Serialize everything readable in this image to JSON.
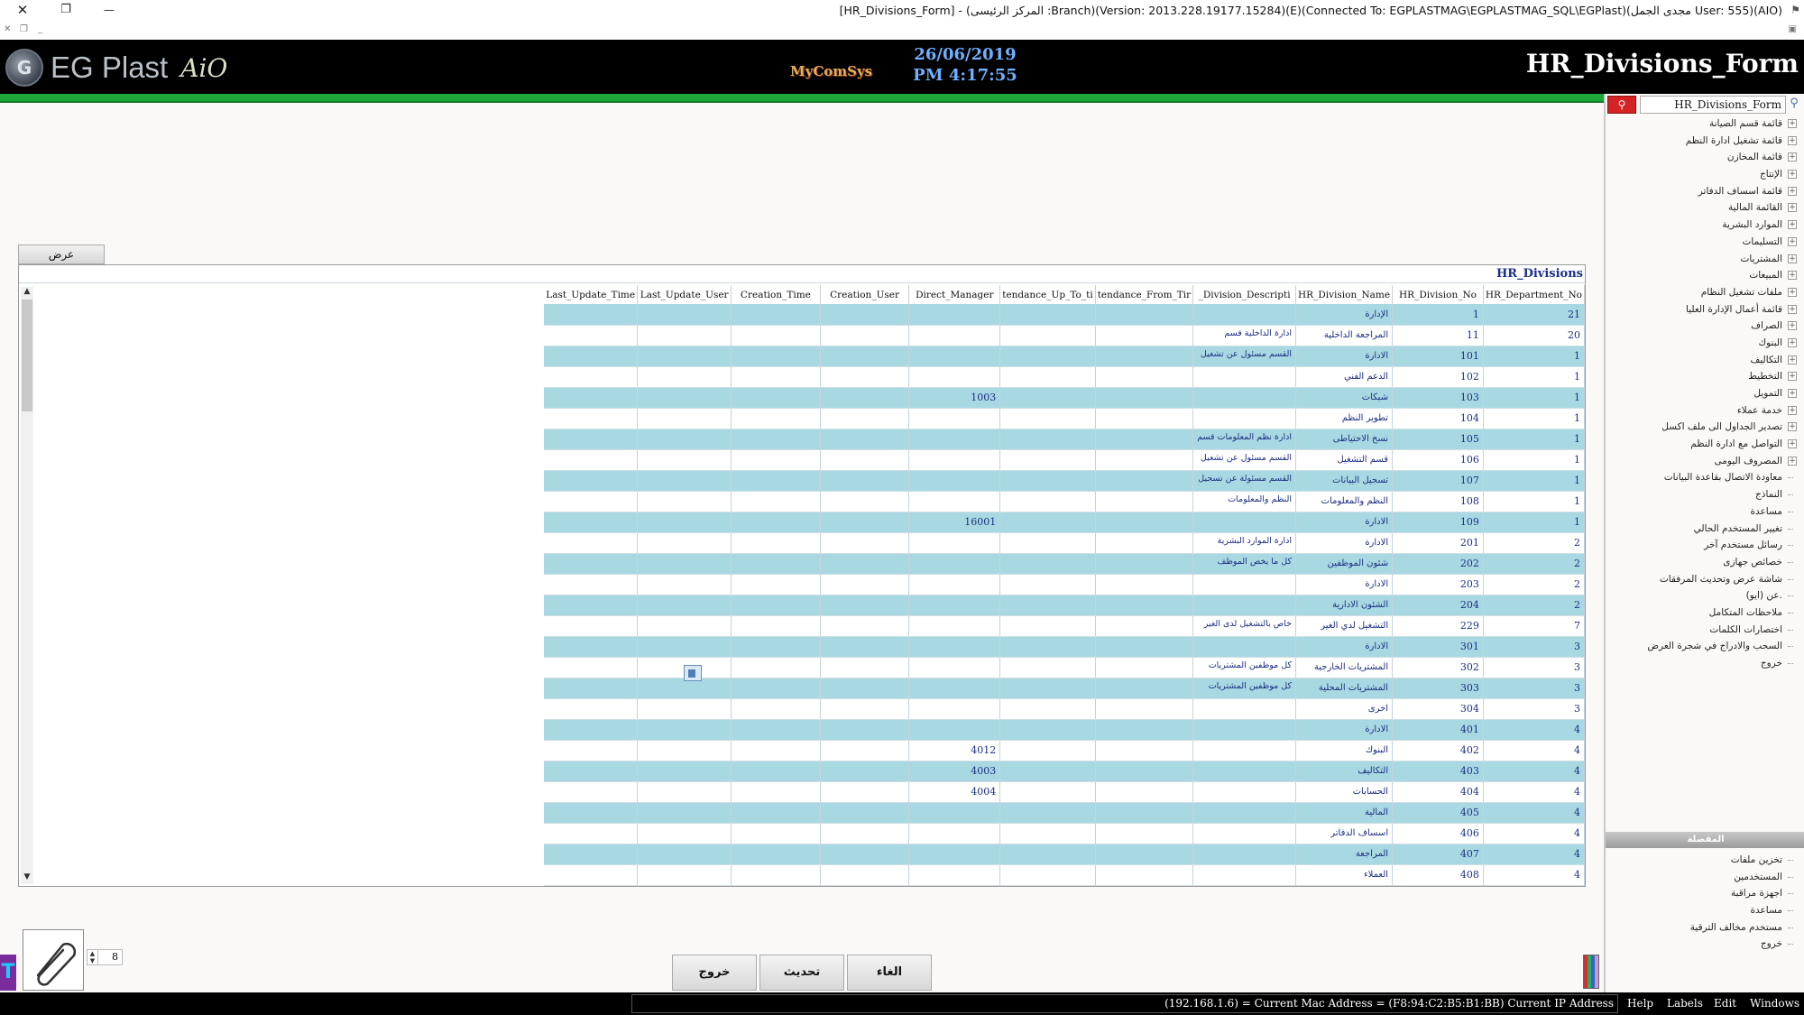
{
  "window": {
    "title": "[HR_Divisions_Form] - (المركز الرئيسى :Branch)(Version: 2013.228.19177.15284)(E)(Connected To: EGPLASTMAG\\EGPLASTMAG_SQL\\EGPlast)(مجدى الجمل User: 555)(AIO)",
    "close_glyph": "✕",
    "restore_glyph": "❐",
    "minimize_glyph": "—"
  },
  "header": {
    "logo_text": "EG Plast",
    "logo_suffix": "AiO",
    "brand": "MyComSys",
    "date": "26/06/2019",
    "time": "PM 4:17:55",
    "form_title": "HR_Divisions_Form"
  },
  "search": {
    "value": "HR_Divisions_Form",
    "button_icon": "search-icon"
  },
  "tree_items": [
    {
      "label": "قائمة قسم الصيانة",
      "expandable": true
    },
    {
      "label": "قائمة تشغيل ادارة النظم",
      "expandable": true
    },
    {
      "label": "قائمة المخازن",
      "expandable": true
    },
    {
      "label": "الإنتاج",
      "expandable": true
    },
    {
      "label": "قائمة اسساف الدفاتر",
      "expandable": true
    },
    {
      "label": "القائمة المالية",
      "expandable": true
    },
    {
      "label": "الموارد البشرية",
      "expandable": true
    },
    {
      "label": "التسليمات",
      "expandable": true
    },
    {
      "label": "المشتريات",
      "expandable": true
    },
    {
      "label": "المبيعات",
      "expandable": true
    },
    {
      "label": "ملفات تشغيل النظام",
      "expandable": true
    },
    {
      "label": "قائمة أعمال الإدارة العليا",
      "expandable": true
    },
    {
      "label": "الصراف",
      "expandable": true
    },
    {
      "label": "البنوك",
      "expandable": true
    },
    {
      "label": "التكاليف",
      "expandable": true
    },
    {
      "label": "التخطيط",
      "expandable": true
    },
    {
      "label": "التمويل",
      "expandable": true
    },
    {
      "label": "خدمة عملاء",
      "expandable": true
    },
    {
      "label": "تصدير الجداول الى ملف اكسل",
      "expandable": true
    },
    {
      "label": "التواصل مع ادارة النظم",
      "expandable": true
    },
    {
      "label": "المصروف اليومى",
      "expandable": true
    },
    {
      "label": "معاودة الاتصال بقاعدة البيانات",
      "expandable": false
    },
    {
      "label": "النماذج",
      "expandable": false
    },
    {
      "label": "مساعدة",
      "expandable": false
    },
    {
      "label": "تغيير المستخدم الحالي",
      "expandable": false
    },
    {
      "label": "رسائل مستخدم آخر",
      "expandable": false
    },
    {
      "label": "خصائص جهازى",
      "expandable": false
    },
    {
      "label": "شاشة عرض وتحديث المرفقات",
      "expandable": false
    },
    {
      "label": "عن (ايو).",
      "expandable": false
    },
    {
      "label": "ملاحظات المتكامل",
      "expandable": false
    },
    {
      "label": "اختصارات الكلمات",
      "expandable": false
    },
    {
      "label": "السحب والادراج في شجرة العرض",
      "expandable": false
    },
    {
      "label": "خروج",
      "expandable": false
    }
  ],
  "favorites": {
    "header": "المفضلة",
    "items": [
      "تخزين ملفات",
      "المستخدمين",
      "اجهزة مراقبة",
      "مساعدة",
      "مستخدم مخالف الترقية",
      "خروج"
    ]
  },
  "view_button": "عرض",
  "grid": {
    "title": "HR_Divisions",
    "columns": [
      "Last_Update_Time",
      "Last_Update_User",
      "Creation_Time",
      "Creation_User",
      "Direct_Manager",
      "tendance_Up_To_ti",
      "tendance_From_Tir",
      "_Division_Descripti",
      "HR_Division_Name",
      "HR_Division_No",
      "HR_Department_No"
    ],
    "rows": [
      {
        "dept": "21",
        "no": "1",
        "name": "الإدارة",
        "desc": "",
        "mgr": ""
      },
      {
        "dept": "20",
        "no": "11",
        "name": "المراجعة الداخلية",
        "desc": "ادارة الداخلية قسم",
        "mgr": ""
      },
      {
        "dept": "1",
        "no": "101",
        "name": "الادارة",
        "desc": "القسم مسئول عن تشغيل",
        "mgr": ""
      },
      {
        "dept": "1",
        "no": "102",
        "name": "الدعم الفني",
        "desc": "",
        "mgr": ""
      },
      {
        "dept": "1",
        "no": "103",
        "name": "شبكات",
        "desc": "",
        "mgr": "1003"
      },
      {
        "dept": "1",
        "no": "104",
        "name": "تطوير النظم",
        "desc": "",
        "mgr": ""
      },
      {
        "dept": "1",
        "no": "105",
        "name": "نسخ الاحتياطى",
        "desc": "ادارة نظم المعلومات قسم",
        "mgr": ""
      },
      {
        "dept": "1",
        "no": "106",
        "name": "قسم التشغيل",
        "desc": "القسم مسئول عن تشغيل",
        "mgr": ""
      },
      {
        "dept": "1",
        "no": "107",
        "name": "تسجيل البيانات",
        "desc": "القسم مسئولة عن تسجيل",
        "mgr": ""
      },
      {
        "dept": "1",
        "no": "108",
        "name": "النظم والمعلومات",
        "desc": "النظم والمعلومات",
        "mgr": ""
      },
      {
        "dept": "1",
        "no": "109",
        "name": "الادارة",
        "desc": "",
        "mgr": "16001"
      },
      {
        "dept": "2",
        "no": "201",
        "name": "الادارة",
        "desc": "ادارة الموارد البشرية",
        "mgr": ""
      },
      {
        "dept": "2",
        "no": "202",
        "name": "شئون الموظفين",
        "desc": "كل ما يخص الموظف",
        "mgr": ""
      },
      {
        "dept": "2",
        "no": "203",
        "name": "الادارة",
        "desc": "",
        "mgr": ""
      },
      {
        "dept": "2",
        "no": "204",
        "name": "الشئون الادارية",
        "desc": "",
        "mgr": ""
      },
      {
        "dept": "7",
        "no": "229",
        "name": "التشغيل لدي الغير",
        "desc": "خاص بالتشغيل لدى الغير",
        "mgr": ""
      },
      {
        "dept": "3",
        "no": "301",
        "name": "الادارة",
        "desc": "",
        "mgr": ""
      },
      {
        "dept": "3",
        "no": "302",
        "name": "المشتريات الخارجية",
        "desc": "كل موظفين المشتريات",
        "mgr": ""
      },
      {
        "dept": "3",
        "no": "303",
        "name": "المشتريات المحلية",
        "desc": "كل موظفين المشتريات",
        "mgr": ""
      },
      {
        "dept": "3",
        "no": "304",
        "name": "اخرى",
        "desc": "",
        "mgr": ""
      },
      {
        "dept": "4",
        "no": "401",
        "name": "الادارة",
        "desc": "",
        "mgr": ""
      },
      {
        "dept": "4",
        "no": "402",
        "name": "البنوك",
        "desc": "",
        "mgr": "4012"
      },
      {
        "dept": "4",
        "no": "403",
        "name": "التكاليف",
        "desc": "",
        "mgr": "4003"
      },
      {
        "dept": "4",
        "no": "404",
        "name": "الحسابات",
        "desc": "",
        "mgr": "4004"
      },
      {
        "dept": "4",
        "no": "405",
        "name": "المالية",
        "desc": "",
        "mgr": ""
      },
      {
        "dept": "4",
        "no": "406",
        "name": "اسساف الدفاتر",
        "desc": "",
        "mgr": ""
      },
      {
        "dept": "4",
        "no": "407",
        "name": "المراجعة",
        "desc": "",
        "mgr": ""
      },
      {
        "dept": "4",
        "no": "408",
        "name": "العملاء",
        "desc": "",
        "mgr": ""
      }
    ]
  },
  "actions": {
    "exit": "خروج",
    "refresh": "تحديث",
    "cancel": "الغاء"
  },
  "attachments_count": "8",
  "statusbar": {
    "address": "(192.168.1.6) = Current Mac Address = (F8:94:C2:B5:B1:BB) Current IP Address",
    "menus": [
      "Help",
      "Labels",
      "Edit",
      "Windows"
    ]
  },
  "colors": {
    "header_bg": "#000000",
    "accent_green": "#1fa83a",
    "row_alt": "#a8d9e3",
    "cell_text": "#1c2e80",
    "date_text": "#6fb0ff",
    "search_red": "#d42323"
  }
}
